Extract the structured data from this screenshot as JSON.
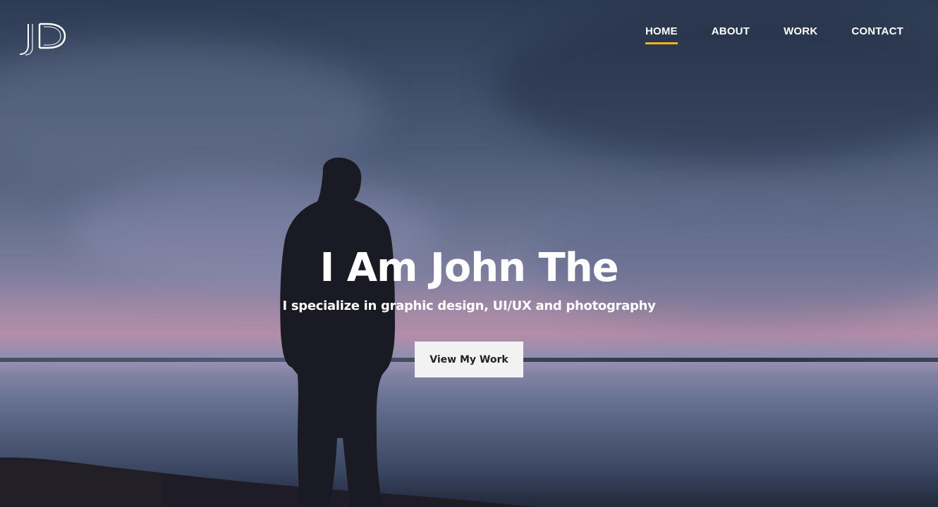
{
  "brand": {
    "logo_text": "JD"
  },
  "nav": {
    "items": [
      {
        "label": "HOME",
        "active": true
      },
      {
        "label": "ABOUT",
        "active": false
      },
      {
        "label": "WORK",
        "active": false
      },
      {
        "label": "CONTACT",
        "active": false
      }
    ],
    "active_indicator_color": "#f2b318"
  },
  "hero": {
    "headline": "I Am John The",
    "subheadline": "I specialize in graphic design, UI/UX and photography",
    "cta_label": "View My Work"
  }
}
